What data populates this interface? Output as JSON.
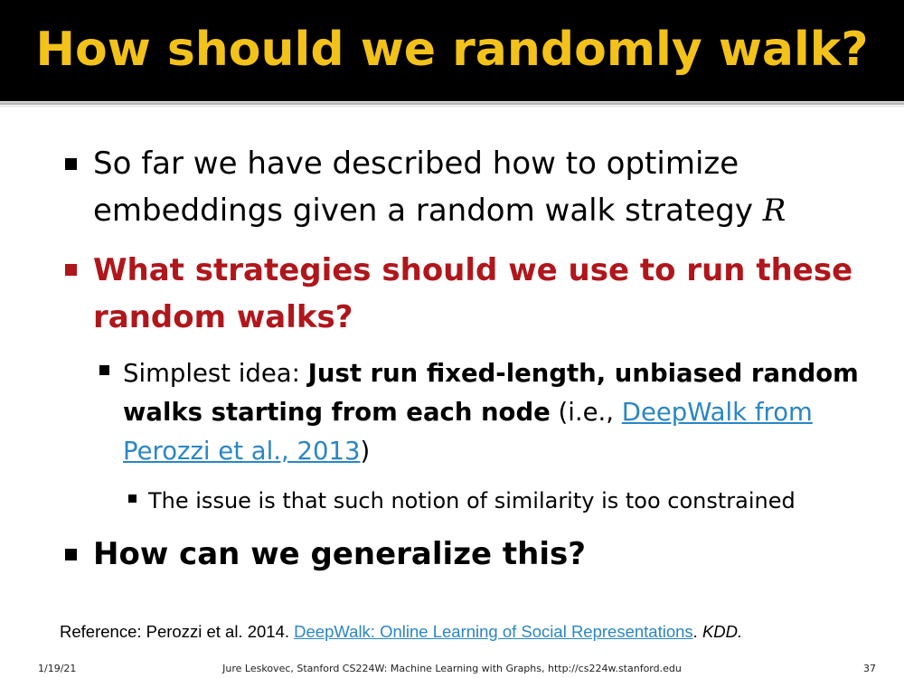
{
  "title": "How should we randomly walk?",
  "bullets": {
    "b1": {
      "text": "So far we have described how to optimize embeddings given a random walk strategy",
      "math": "R"
    },
    "b2": {
      "text": "What strategies should we use to run these random walks?"
    },
    "b3": {
      "prefix": "Simplest idea: ",
      "bold": "Just run fixed-length, unbiased random walks starting from each node",
      "mid": " (i.e., ",
      "link": "DeepWalk from Perozzi et al., 2013",
      "suffix": ")"
    },
    "b4": {
      "text": "The issue is that such notion of similarity is too constrained"
    },
    "b5": {
      "text": "How can we generalize this?"
    }
  },
  "reference": {
    "prefix": "Reference: Perozzi et al. 2014. ",
    "link": "DeepWalk: Online Learning of Social Representations",
    "period": ". ",
    "venue": "KDD."
  },
  "footer": {
    "date": "1/19/21",
    "center": "Jure Leskovec, Stanford CS224W: Machine Learning with Graphs, http://cs224w.stanford.edu",
    "page": "37"
  },
  "colors": {
    "title": "#f2c21b",
    "title_bg": "#000000",
    "emphasis_red": "#b0161b",
    "link_blue": "#2a86c5"
  }
}
